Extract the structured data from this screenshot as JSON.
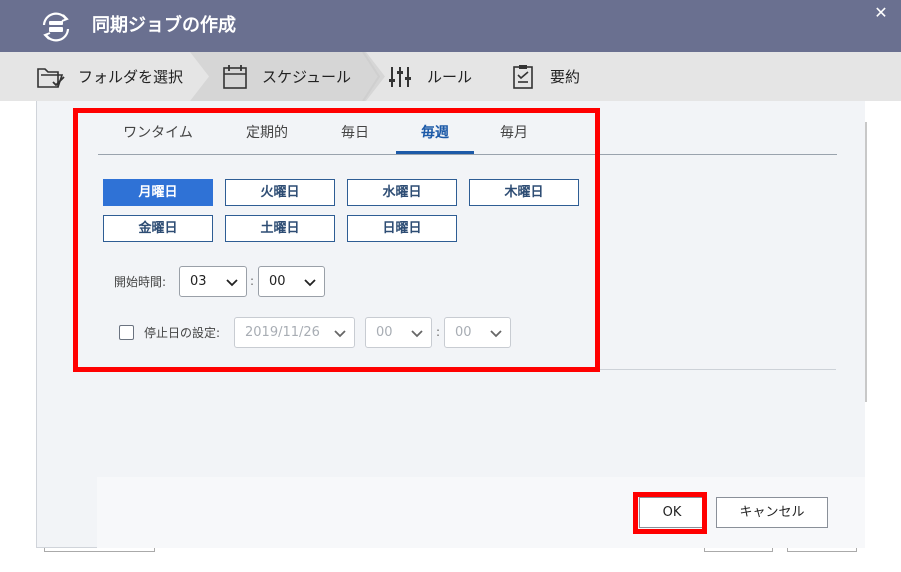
{
  "window": {
    "title": "同期ジョブの作成"
  },
  "steps": [
    {
      "label": "フォルダを選択",
      "icon": "folder-check-icon"
    },
    {
      "label": "スケジュール",
      "icon": "calendar-icon"
    },
    {
      "label": "ルール",
      "icon": "sliders-icon"
    },
    {
      "label": "要約",
      "icon": "clipboard-icon"
    }
  ],
  "tabs": [
    "ワンタイム",
    "定期的",
    "毎日",
    "毎週",
    "毎月"
  ],
  "active_tab": "毎週",
  "days": [
    {
      "label": "月曜日",
      "selected": true
    },
    {
      "label": "火曜日",
      "selected": false
    },
    {
      "label": "水曜日",
      "selected": false
    },
    {
      "label": "木曜日",
      "selected": false
    },
    {
      "label": "金曜日",
      "selected": false
    },
    {
      "label": "土曜日",
      "selected": false
    },
    {
      "label": "日曜日",
      "selected": false
    }
  ],
  "start_time": {
    "label": "開始時間:",
    "hour": "03",
    "minute": "00",
    "separator": ":"
  },
  "stop_date": {
    "label": "停止日の設定:",
    "checked": false,
    "date": "2019/11/26",
    "hour": "00",
    "minute": "00",
    "separator": ":"
  },
  "buttons": {
    "ok": "OK",
    "cancel": "キャンセル"
  },
  "colors": {
    "titlebar": "#6a7090",
    "accent": "#2f72d6",
    "tab_active": "#1d5aa8",
    "highlight": "#ff0000"
  }
}
